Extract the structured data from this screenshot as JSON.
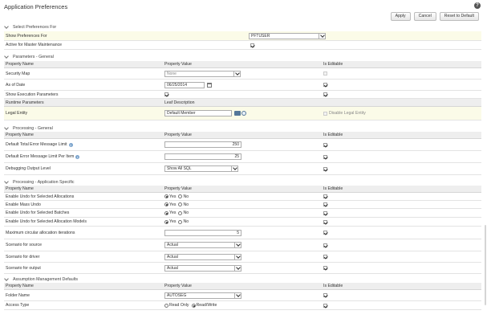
{
  "title": "Application Preferences",
  "toolbar": {
    "apply": "Apply",
    "cancel": "Cancel",
    "reset": "Reset to Default"
  },
  "sec_select": {
    "header": "Select Preferences For",
    "show_label": "Show Preferences For",
    "show_value": "PFTUSER",
    "master_label": "Active for Master Maintenance"
  },
  "sec_params": {
    "header": "Parameters - General",
    "col_name": "Property Name",
    "col_value": "Property Value",
    "col_edit": "Is Editable",
    "security_map": "Security Map",
    "security_map_value": "None",
    "as_of_date": "As of Date",
    "as_of_date_value": "06/25/2014",
    "show_exec": "Show Execution Parameters",
    "runtime_params": "Runtime Parameters",
    "leaf_desc": "Leaf Description",
    "legal_entity": "Legal Entity",
    "legal_entity_value": "Default Member",
    "disable_legal": "Disable Legal Entity"
  },
  "sec_proc": {
    "header": "Processing - General",
    "col_name": "Property Name",
    "col_value": "Property Value",
    "col_edit": "Is Editable",
    "total_err": "Default Total Error Message Limit",
    "total_err_value": "250",
    "err_per_item": "Default Error Message Limit Per Item",
    "err_per_item_value": "25",
    "debug_level": "Debugging Output Level",
    "debug_level_value": "Show All SQL"
  },
  "sec_app": {
    "header": "Processing - Application Specific",
    "col_name": "Property Name",
    "col_value": "Property Value",
    "col_edit": "Is Editable",
    "yes": "Yes",
    "no": "No",
    "undo_alloc": "Enable Undo for Selected Allocations",
    "mass_undo": "Enable Mass Undo",
    "undo_batches": "Enable Undo for Selected Batches",
    "undo_models": "Enable Undo for Selected Allocation Models",
    "max_iter": "Maximum circular allocation iterations",
    "max_iter_value": "5",
    "scen_source": "Scenario for source",
    "scen_source_value": "Actual",
    "scen_driver": "Scenario for driver",
    "scen_driver_value": "Actual",
    "scen_output": "Scenario for output",
    "scen_output_value": "Actual"
  },
  "sec_assump": {
    "header": "Assumption Management Defaults",
    "col_name": "Property Name",
    "col_value": "Property Value",
    "col_edit": "Is Editable",
    "folder": "Folder Name",
    "folder_value": "AUTOSEG",
    "access": "Access Type",
    "read_only": "Read Only",
    "read_write": "Read/Write"
  }
}
